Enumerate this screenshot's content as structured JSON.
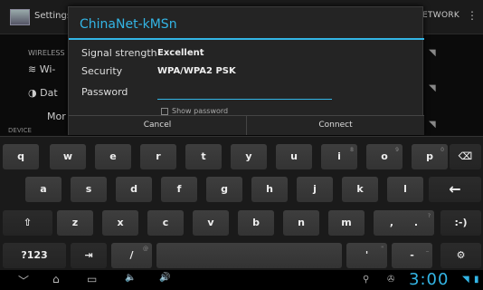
{
  "background": {
    "app_title": "Settings",
    "network_label": "ETWORK",
    "overflow_icon": "⋮",
    "wireless_header": "WIRELESS",
    "wifi_label": "Wi-",
    "data_label": "Dat",
    "more_label": "Mor",
    "device_header": "DEVICE"
  },
  "dialog": {
    "title": "ChinaNet-kMSn",
    "signal_label": "Signal strength",
    "signal_value": "Excellent",
    "security_label": "Security",
    "security_value": "WPA/WPA2 PSK",
    "password_label": "Password",
    "password_value": "",
    "show_password_label": "Show password",
    "cancel_label": "Cancel",
    "connect_label": "Connect"
  },
  "keyboard": {
    "row1": [
      "q",
      "w",
      "e",
      "r",
      "t",
      "y",
      "u",
      "i",
      "o",
      "p"
    ],
    "row2": [
      "a",
      "s",
      "d",
      "f",
      "g",
      "h",
      "j",
      "k",
      "l"
    ],
    "row3": [
      "z",
      "x",
      "c",
      "v",
      "b",
      "n",
      "m",
      ",",
      "."
    ],
    "backspace": "⌫",
    "enter": "←",
    "shift": "⇧",
    "smiley": ":-)",
    "symbols": "?123",
    "tab": "⇥",
    "slash": "/",
    "apostrophe": "'",
    "dash": "-",
    "settings_key": "⚙",
    "hints": {
      "i": "8",
      "o": "9",
      "p": "0",
      "comma": "!",
      "period": "?",
      "slash": "@",
      "apostrophe": "\"",
      "dash": "_"
    }
  },
  "navbar": {
    "back_icon": "﹀",
    "home_icon": "⌂",
    "recent_icon": "▭",
    "vol_down_icon": "🔈",
    "vol_up_icon": "🔊",
    "usb_icon": "⚲",
    "clock": "3:00"
  }
}
